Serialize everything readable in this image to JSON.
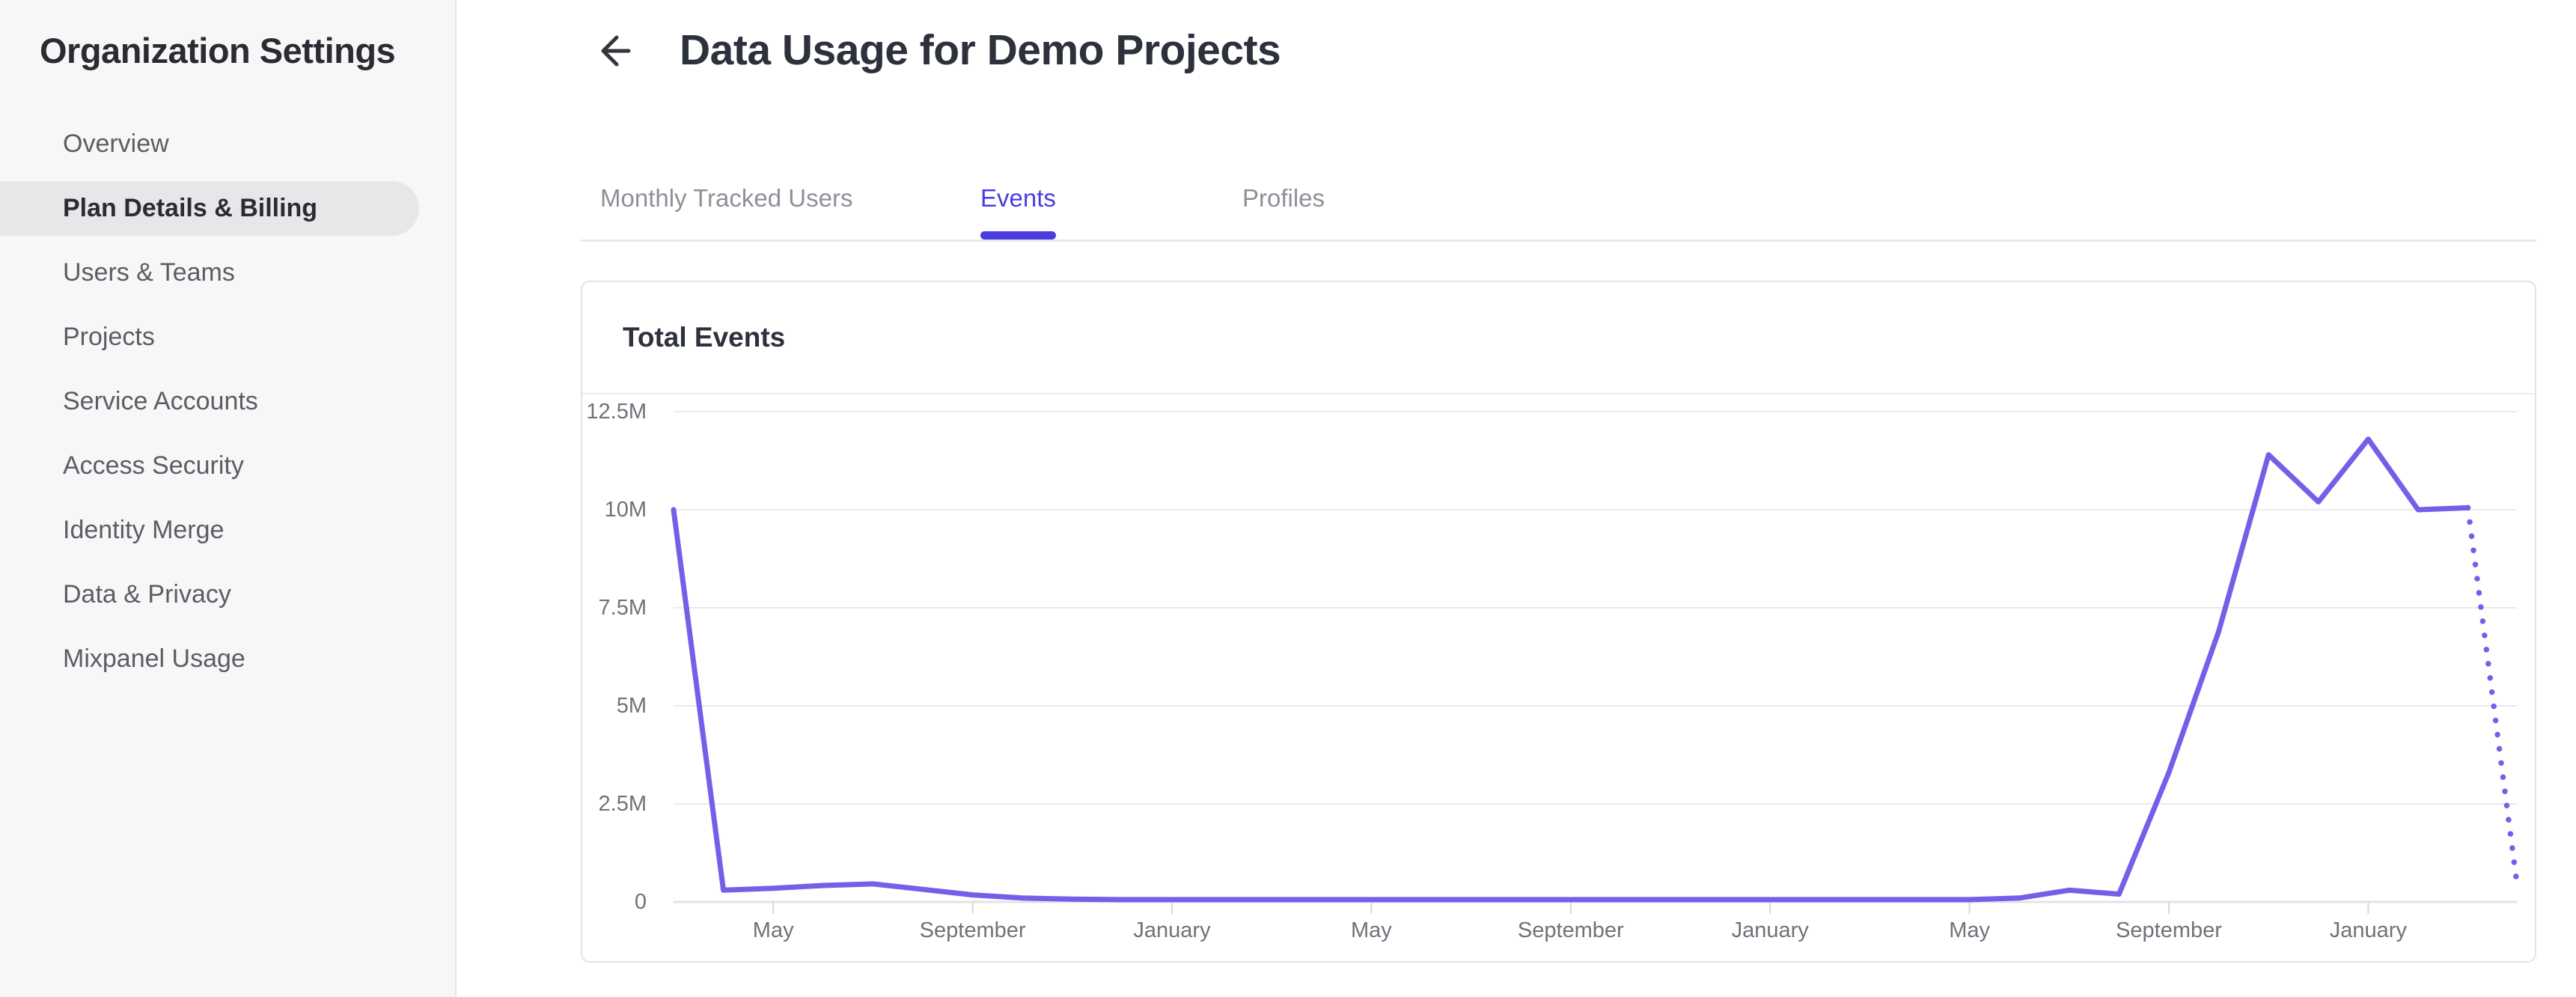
{
  "sidebar": {
    "title": "Organization Settings",
    "items": [
      {
        "label": "Overview",
        "active": false
      },
      {
        "label": "Plan Details & Billing",
        "active": true
      },
      {
        "label": "Users & Teams",
        "active": false
      },
      {
        "label": "Projects",
        "active": false
      },
      {
        "label": "Service Accounts",
        "active": false
      },
      {
        "label": "Access Security",
        "active": false
      },
      {
        "label": "Identity Merge",
        "active": false
      },
      {
        "label": "Data & Privacy",
        "active": false
      },
      {
        "label": "Mixpanel Usage",
        "active": false
      }
    ]
  },
  "header": {
    "title": "Data Usage for Demo Projects",
    "back_icon": "left-arrow"
  },
  "tabs": [
    {
      "label": "Monthly Tracked Users",
      "active": false
    },
    {
      "label": "Events",
      "active": true
    },
    {
      "label": "Profiles",
      "active": false
    }
  ],
  "card": {
    "title": "Total Events"
  },
  "chart_data": {
    "type": "line",
    "title": "Total Events",
    "legend": "none",
    "x_axis": {
      "granularity": "monthly",
      "tick_labels": [
        "May",
        "September",
        "January",
        "May",
        "September",
        "January",
        "May",
        "September",
        "January"
      ],
      "tick_month_indices": [
        2,
        6,
        10,
        14,
        18,
        22,
        26,
        30,
        34
      ]
    },
    "y_axis": {
      "ylim_m": [
        0,
        12.5
      ],
      "grid": true,
      "ticks": [
        {
          "label": "12.5M",
          "value_m": 12.5
        },
        {
          "label": "10M",
          "value_m": 10
        },
        {
          "label": "7.5M",
          "value_m": 7.5
        },
        {
          "label": "5M",
          "value_m": 5
        },
        {
          "label": "2.5M",
          "value_m": 2.5
        },
        {
          "label": "0",
          "value_m": 0
        }
      ]
    },
    "series": [
      {
        "name": "Total Events",
        "color": "#7460e8",
        "style": "solid",
        "values_m": [
          10,
          0.3,
          0.35,
          0.42,
          0.46,
          0.32,
          0.18,
          0.1,
          0.07,
          0.06,
          0.06,
          0.06,
          0.06,
          0.06,
          0.06,
          0.06,
          0.06,
          0.06,
          0.06,
          0.06,
          0.06,
          0.06,
          0.06,
          0.06,
          0.06,
          0.06,
          0.06,
          0.1,
          0.3,
          0.2,
          3.3,
          6.9,
          11.4,
          10.2,
          11.8,
          10.0,
          10.05
        ]
      }
    ],
    "projection": {
      "style": "dotted",
      "color": "#7460e8",
      "from_month_index": 36,
      "to_month_index": 37,
      "end_value_m": 0.3
    }
  },
  "colors": {
    "accent": "#4b3ce0",
    "line": "#7460e8",
    "grid": "#eaeaea",
    "axis_text": "#71717a"
  }
}
